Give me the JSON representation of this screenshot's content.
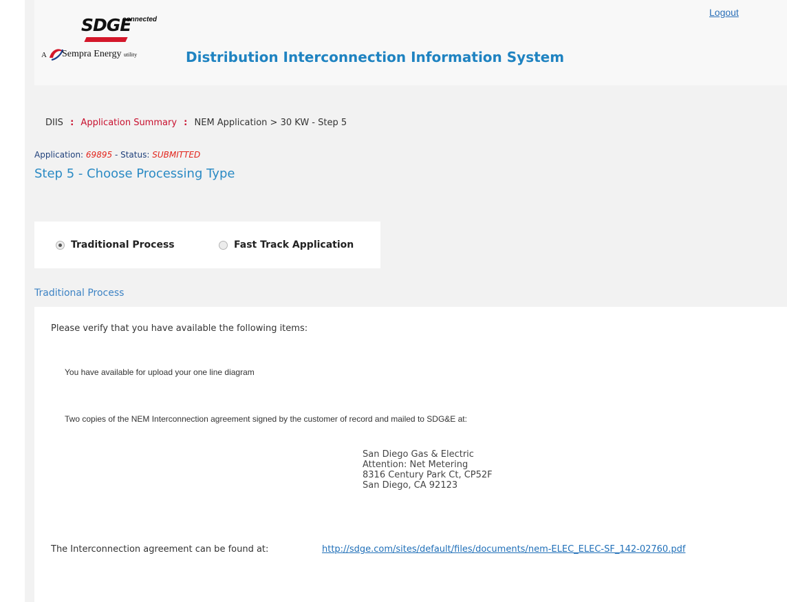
{
  "header": {
    "logo": {
      "brand": "SDGE",
      "tagline": "connected",
      "parent_prefix": "A",
      "parent": "Sempra Energy",
      "parent_suffix": "utility"
    },
    "title": "Distribution Interconnection Information System",
    "logout_label": "Logout"
  },
  "breadcrumb": {
    "items": [
      "DIIS",
      "Application Summary",
      "NEM Application > 30 KW - Step 5"
    ],
    "separator": ":"
  },
  "application": {
    "label": "Application:",
    "id": "69895",
    "status_label": "- Status:",
    "status": "SUBMITTED"
  },
  "step_title": "Step 5 - Choose Processing Type",
  "processing_options": [
    {
      "label": "Traditional Process",
      "selected": true
    },
    {
      "label": "Fast Track Application",
      "selected": false
    }
  ],
  "section": {
    "title": "Traditional Process",
    "intro": "Please verify that you have available the following items:",
    "items": [
      "You have available for upload your one line diagram",
      "Two copies of the NEM Interconnection agreement signed by the customer of record and mailed to SDG&E at:"
    ],
    "address": [
      "San Diego Gas & Electric",
      "Attention: Net Metering",
      "8316 Century Park Ct, CP52F",
      "San Diego, CA 92123"
    ],
    "agreement_label": "The Interconnection agreement can be found at:",
    "agreement_url": "http://sdge.com/sites/default/files/documents/nem-ELEC_ELEC-SF_142-02760.pdf"
  },
  "colors": {
    "title_blue": "#1f83c1",
    "link_blue": "#1f6fb8",
    "accent_red": "#c8102e",
    "status_red": "#e2231a"
  }
}
